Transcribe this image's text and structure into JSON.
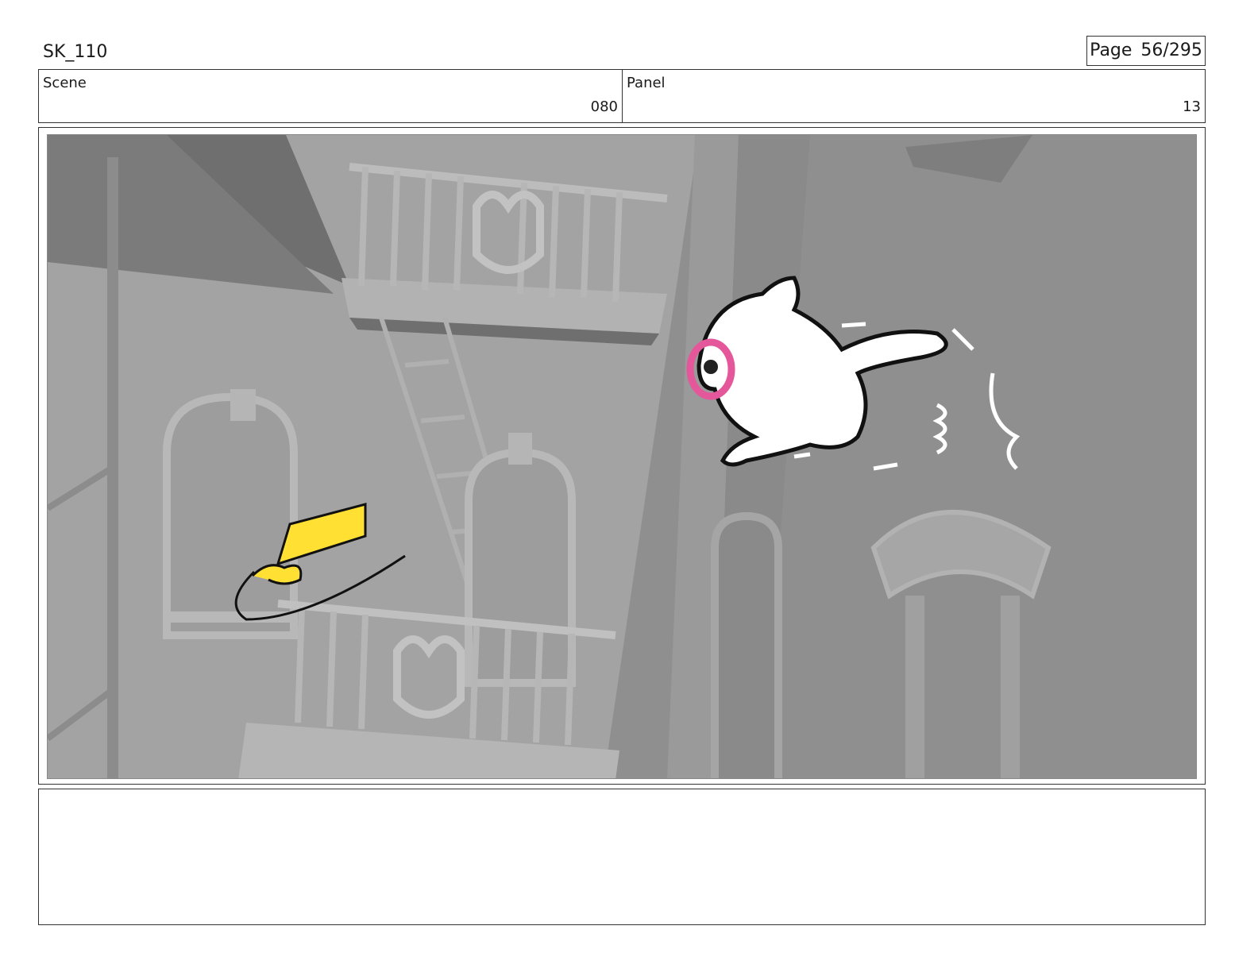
{
  "header": {
    "sheet_title": "SK_110",
    "page_label": "Page 56/295"
  },
  "info": {
    "scene_label": "Scene",
    "scene_value": "080",
    "panel_label": "Panel",
    "panel_value": "13"
  },
  "artwork": {
    "description_icons": [
      "building-facade",
      "fire-escape-balcony",
      "arched-window",
      "white-cat-character",
      "yellow-object"
    ],
    "colors": {
      "wall_dark": "#6f6f6f",
      "wall_mid": "#8f8f8f",
      "wall_light": "#a3a3a3",
      "accent_yellow": "#ffe033",
      "accent_pink": "#e4579a"
    }
  },
  "notes": {
    "text": ""
  }
}
